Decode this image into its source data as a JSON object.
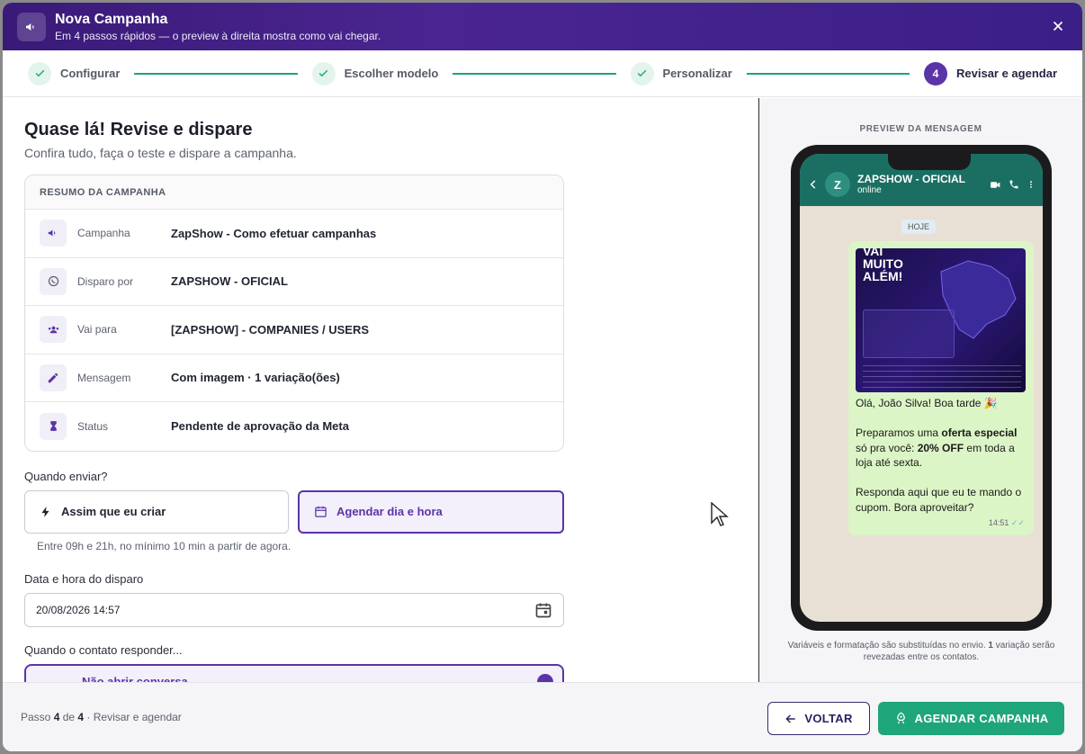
{
  "header": {
    "title": "Nova Campanha",
    "subtitle": "Em 4 passos rápidos — o preview à direita mostra como vai chegar."
  },
  "stepper": {
    "steps": [
      {
        "label": "Configurar",
        "state": "done"
      },
      {
        "label": "Escolher modelo",
        "state": "done"
      },
      {
        "label": "Personalizar",
        "state": "done"
      },
      {
        "label": "Revisar e agendar",
        "state": "current",
        "number": "4"
      }
    ]
  },
  "main": {
    "title": "Quase lá! Revise e dispare",
    "subtitle": "Confira tudo, faça o teste e dispare a campanha.",
    "summary": {
      "heading": "RESUMO DA CAMPANHA",
      "rows": [
        {
          "label": "Campanha",
          "value": "ZapShow - Como efetuar campanhas",
          "icon": "megaphone-icon"
        },
        {
          "label": "Disparo por",
          "value": "ZAPSHOW - OFICIAL",
          "icon": "whatsapp-icon"
        },
        {
          "label": "Vai para",
          "value": "[ZAPSHOW] - COMPANIES / USERS",
          "icon": "group-icon"
        },
        {
          "label": "Mensagem",
          "value": "Com imagem · 1 variação(ões)",
          "icon": "pencil-icon"
        },
        {
          "label": "Status",
          "value": "Pendente de aprovação da Meta",
          "icon": "hourglass-icon"
        }
      ]
    },
    "when": {
      "label": "Quando enviar?",
      "option_now": "Assim que eu criar",
      "option_schedule": "Agendar dia e hora",
      "selected": "schedule",
      "hint": "Entre 09h e 21h, no mínimo 10 min a partir de agora."
    },
    "datetime": {
      "label": "Data e hora do disparo",
      "value": "20/08/2026 14:57"
    },
    "reply": {
      "label": "Quando o contato responder...",
      "option": "Não abrir conversa"
    }
  },
  "preview": {
    "label": "PREVIEW DA MENSAGEM",
    "contact_name": "ZAPSHOW - OFICIAL",
    "contact_status": "online",
    "avatar_letter": "Z",
    "date_chip": "HOJE",
    "msg_line1": "Olá, João Silva! Boa tarde 🎉",
    "msg_p2a": "Preparamos uma ",
    "msg_p2b": "oferta especial",
    "msg_p2c": " só pra você: ",
    "msg_p2d": "20% OFF",
    "msg_p2e": " em toda a loja até sexta.",
    "msg_p3": "Responda aqui que eu te mando o cupom. Bora aproveitar?",
    "time": "14:51",
    "image_headline": "VAI MUITO ALÉM!",
    "footnote_a": "Variáveis e formatação são substituídas no envio. ",
    "footnote_b": "1",
    "footnote_c": " variação serão revezadas entre os contatos."
  },
  "footer": {
    "step_prefix": "Passo ",
    "step_current": "4",
    "step_mid": " de ",
    "step_total": "4",
    "step_suffix": " · Revisar e agendar",
    "back_label": "VOLTAR",
    "submit_label": "AGENDAR CAMPANHA"
  },
  "colors": {
    "accent": "#5b34a8",
    "success": "#1fa57a",
    "header": "#3a1a78",
    "whatsapp_header": "#1a6f62"
  }
}
